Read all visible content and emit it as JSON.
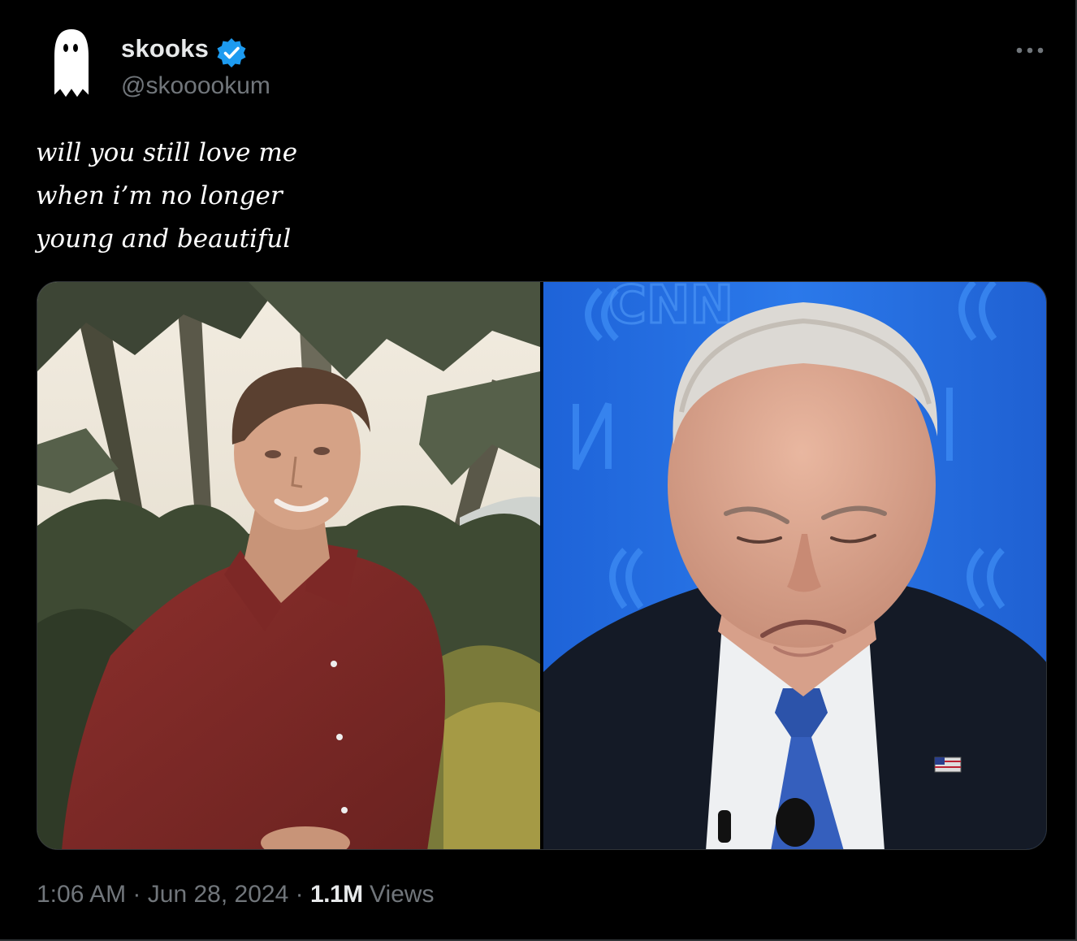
{
  "colors": {
    "background": "#000000",
    "primary_text": "#e7e9ea",
    "secondary_text": "#71767b",
    "verified_badge": "#1d9bf0",
    "border": "#2f3336"
  },
  "author": {
    "display_name": "skooks",
    "handle": "@skooookum",
    "verified": true,
    "avatar_icon": "ghost-icon",
    "verified_icon": "verified-badge-icon"
  },
  "more_icon": "more-options-icon",
  "tweet": {
    "text_lines": [
      "will you still love me",
      "when i’m no longer",
      "young and beautiful"
    ]
  },
  "media": {
    "count": 2,
    "items": [
      {
        "kind": "photo",
        "icon": "vintage-portrait-photo"
      },
      {
        "kind": "photo",
        "icon": "debate-stage-photo",
        "background_text": "CNN"
      }
    ]
  },
  "meta": {
    "time": "1:06 AM",
    "separator": "·",
    "date": "Jun 28, 2024",
    "views_count": "1.1M",
    "views_label": "Views"
  }
}
